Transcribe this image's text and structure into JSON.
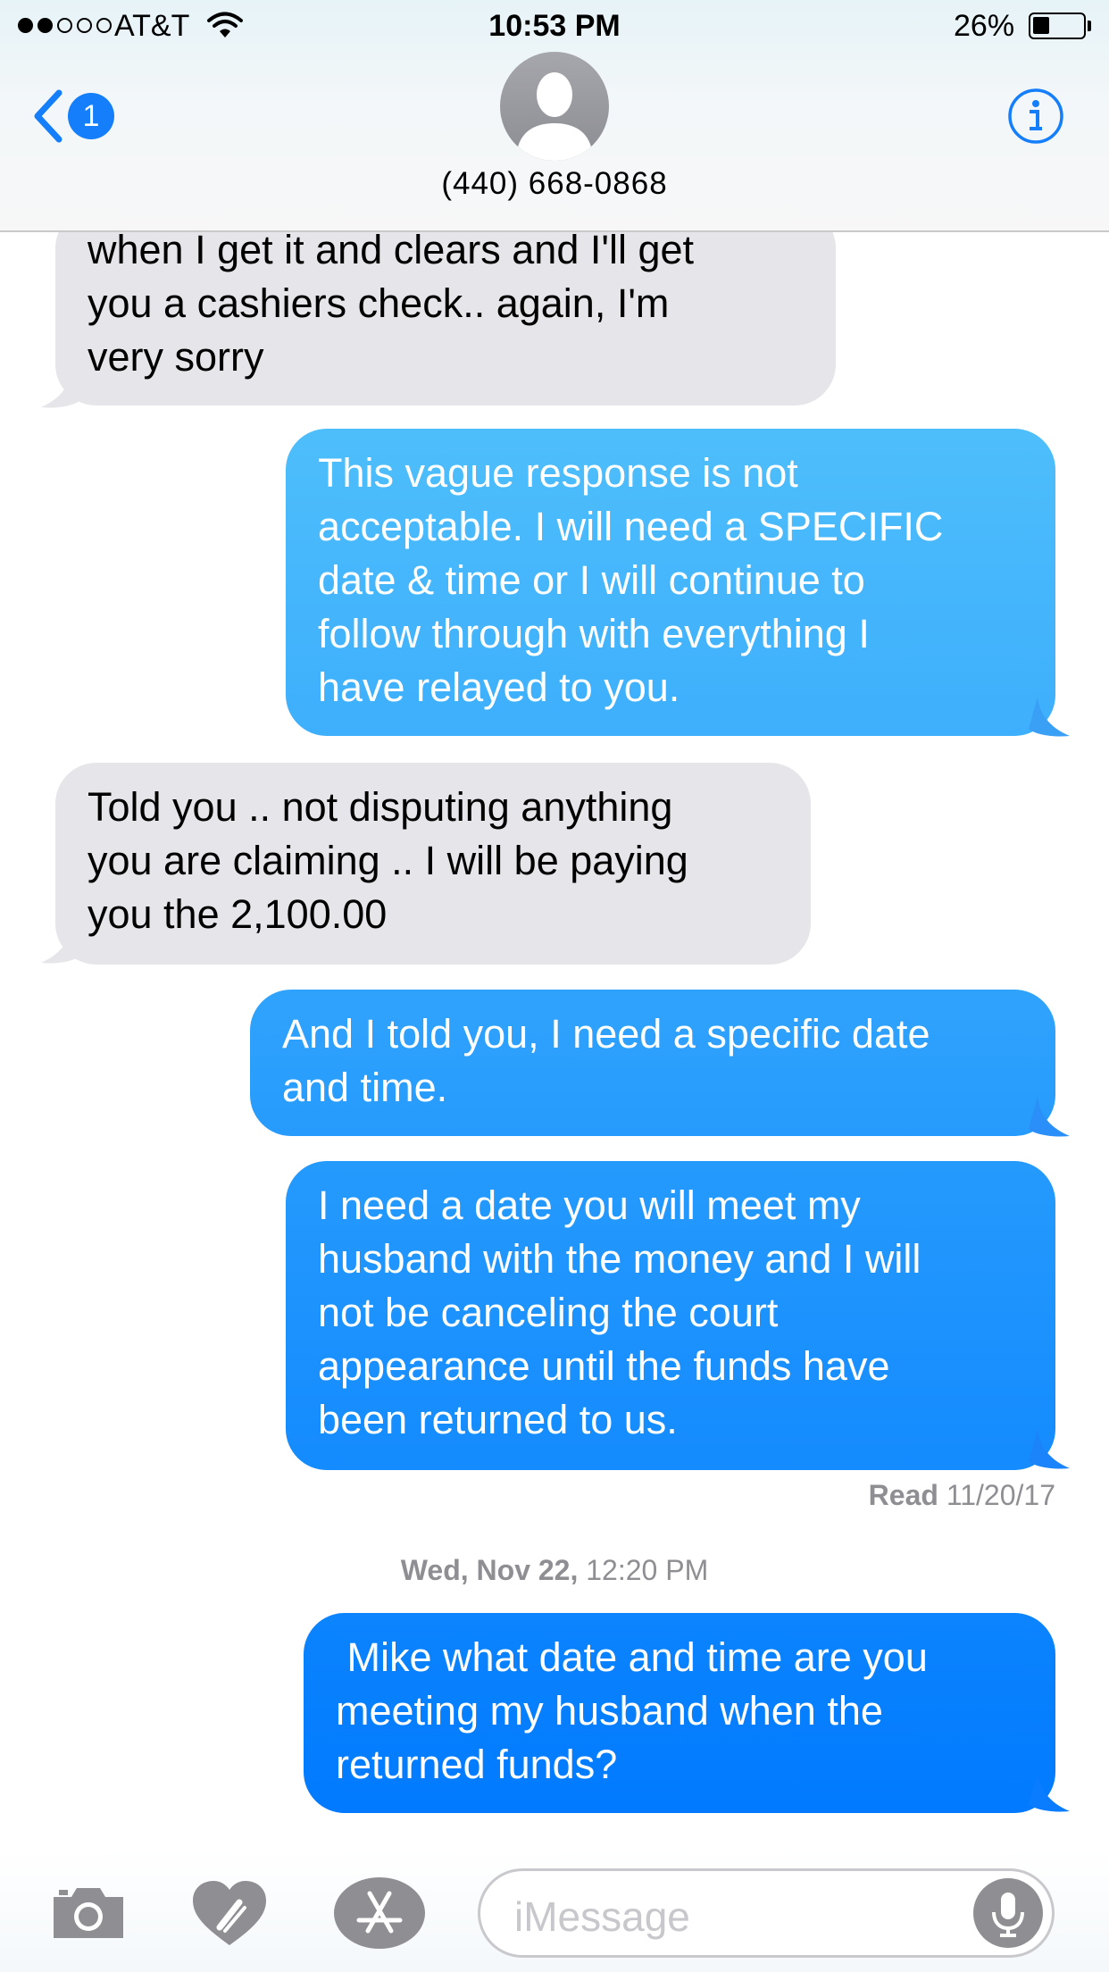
{
  "status_bar": {
    "carrier": "AT&T",
    "time": "10:53 PM",
    "battery_percent_label": "26%",
    "battery_level": 0.26,
    "signal_bars_filled": 2,
    "signal_bars_total": 5
  },
  "header": {
    "back_badge": "1",
    "contact_number": "(440) 668-0868",
    "accent_color": "#147efb"
  },
  "messages": [
    {
      "direction": "received",
      "text": "when I get it and clears and I'll get\nyou a cashiers check.. again, I'm\nvery sorry"
    },
    {
      "direction": "sent",
      "text": "This vague response is not\nacceptable. I will need a SPECIFIC\ndate & time or I will continue to\nfollow through with everything I\nhave relayed to you."
    },
    {
      "direction": "received",
      "text": "Told you .. not disputing anything\nyou are claiming .. I will be paying\nyou the 2,100.00"
    },
    {
      "direction": "sent",
      "text": "And I told you, I need a specific date\nand time."
    },
    {
      "direction": "sent",
      "text": "I need a date you will meet my\nhusband with the money and I will\nnot be canceling the court\nappearance until the funds have\nbeen returned to us."
    },
    {
      "direction": "sent",
      "text": " Mike what date and time are you\nmeeting my husband when the\nreturned funds?"
    }
  ],
  "read_receipt": {
    "label": "Read",
    "date": "11/20/17"
  },
  "timestamp": {
    "day": "Wed, Nov 22,",
    "time": "12:20 PM"
  },
  "input_bar": {
    "placeholder": "iMessage",
    "icons": [
      "camera-icon",
      "digital-touch-heart-icon",
      "app-store-icon",
      "microphone-icon"
    ]
  },
  "colors": {
    "received_bubble": "#e5e5ea",
    "sent_gradient_top": "#5ac8fa",
    "sent_gradient_bottom": "#007aff"
  }
}
